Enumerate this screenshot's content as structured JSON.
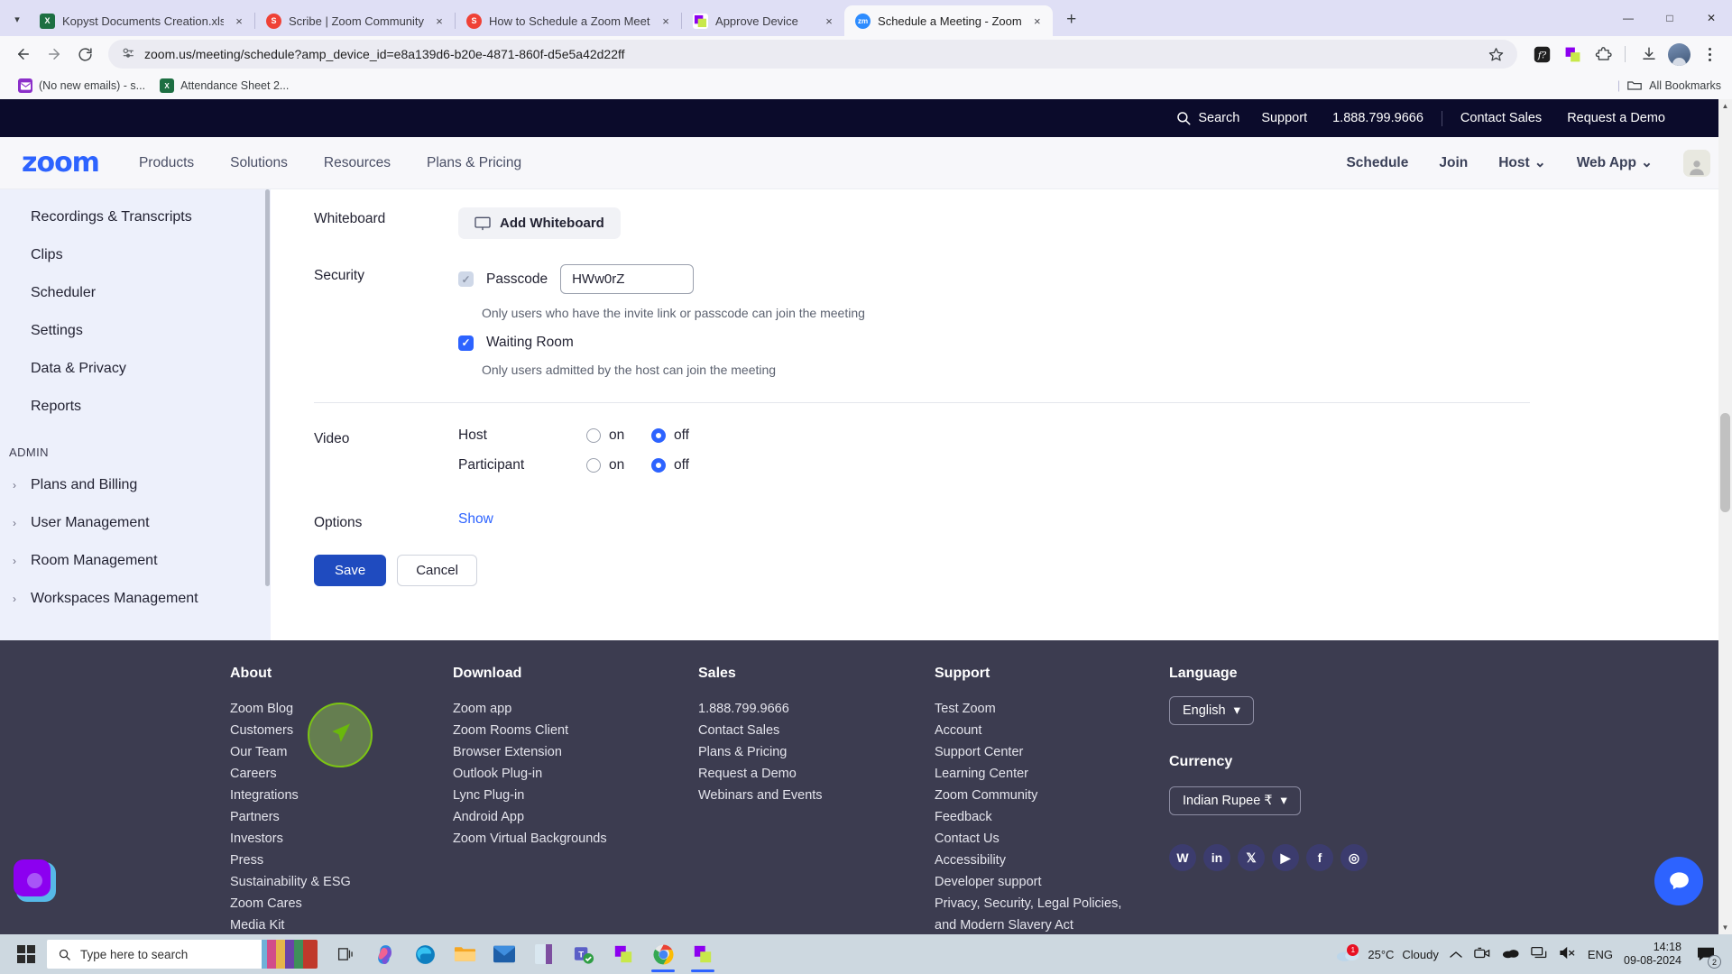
{
  "browser": {
    "tabs": [
      {
        "title": "Kopyst Documents Creation.xlsx",
        "icon": "excel-icon",
        "active": false
      },
      {
        "title": "Scribe | Zoom Community",
        "icon": "scribe-icon",
        "active": false
      },
      {
        "title": "How to Schedule a Zoom Meeti",
        "icon": "scribe-icon",
        "active": false
      },
      {
        "title": "Approve Device",
        "icon": "kopyst-icon",
        "active": false
      },
      {
        "title": "Schedule a Meeting - Zoom",
        "icon": "zoom-icon",
        "active": true
      }
    ],
    "new_tab_label": "+",
    "tab_close_label": "×",
    "window_controls": {
      "minimize": "—",
      "maximize": "□",
      "close": "✕"
    },
    "url": "zoom.us/meeting/schedule?amp_device_id=e8a139d6-b20e-4871-860f-d5e5a42d22ff",
    "toolbar_icons": [
      "back-icon",
      "forward-icon",
      "reload-icon",
      "site-info-icon",
      "bookmark-star-icon",
      "grammarly-icon",
      "kopyst-icon",
      "extensions-icon",
      "downloads-icon",
      "profile-avatar-icon",
      "chrome-menu-icon"
    ],
    "bookmarks": [
      {
        "label": "(No new emails) - s...",
        "icon": "mail-icon"
      },
      {
        "label": "Attendance Sheet 2...",
        "icon": "excel-icon"
      }
    ],
    "all_bookmarks_label": "All Bookmarks"
  },
  "zoom_utility": {
    "search_label": "Search",
    "links": [
      "Support",
      "1.888.799.9666"
    ],
    "right_links": [
      "Contact Sales",
      "Request a Demo"
    ]
  },
  "zoom_nav": {
    "logo": "zoom",
    "links": [
      "Products",
      "Solutions",
      "Resources",
      "Plans & Pricing"
    ],
    "right_links": [
      {
        "label": "Schedule",
        "caret": false
      },
      {
        "label": "Join",
        "caret": false
      },
      {
        "label": "Host",
        "caret": true
      },
      {
        "label": "Web App",
        "caret": true
      }
    ],
    "caret": "⌄"
  },
  "sidebar": {
    "items": [
      {
        "label": "Recordings & Transcripts",
        "caret": false
      },
      {
        "label": "Clips",
        "caret": false
      },
      {
        "label": "Scheduler",
        "caret": false
      },
      {
        "label": "Settings",
        "caret": false
      },
      {
        "label": "Data & Privacy",
        "caret": false
      },
      {
        "label": "Reports",
        "caret": false
      }
    ],
    "section_label": "ADMIN",
    "admin_items": [
      {
        "label": "Plans and Billing",
        "caret": true
      },
      {
        "label": "User Management",
        "caret": true
      },
      {
        "label": "Room Management",
        "caret": true
      },
      {
        "label": "Workspaces Management",
        "caret": true
      }
    ],
    "caret": "›"
  },
  "form": {
    "whiteboard": {
      "label": "Whiteboard",
      "button_label": "Add Whiteboard"
    },
    "security": {
      "label": "Security",
      "passcode_label": "Passcode",
      "passcode_value": "HWw0rZ",
      "passcode_checked": true,
      "passcode_helper": "Only users who have the invite link or passcode can join the meeting",
      "waiting_room_label": "Waiting Room",
      "waiting_room_checked": true,
      "waiting_room_helper": "Only users admitted by the host can join the meeting",
      "check_glyph": "✓"
    },
    "video": {
      "label": "Video",
      "rows": [
        {
          "name": "Host",
          "on_label": "on",
          "off_label": "off",
          "selected": "off"
        },
        {
          "name": "Participant",
          "on_label": "on",
          "off_label": "off",
          "selected": "off"
        }
      ]
    },
    "options": {
      "label": "Options",
      "show_label": "Show"
    },
    "buttons": {
      "save_label": "Save",
      "cancel_label": "Cancel"
    }
  },
  "footer": {
    "columns": [
      {
        "heading": "About",
        "links": [
          "Zoom Blog",
          "Customers",
          "Our Team",
          "Careers",
          "Integrations",
          "Partners",
          "Investors",
          "Press",
          "Sustainability & ESG",
          "Zoom Cares",
          "Media Kit"
        ]
      },
      {
        "heading": "Download",
        "links": [
          "Zoom app",
          "Zoom Rooms Client",
          "Browser Extension",
          "Outlook Plug-in",
          "Lync Plug-in",
          "Android App",
          "Zoom Virtual Backgrounds"
        ]
      },
      {
        "heading": "Sales",
        "links": [
          "1.888.799.9666",
          "Contact Sales",
          "Plans & Pricing",
          "Request a Demo",
          "Webinars and Events"
        ]
      },
      {
        "heading": "Support",
        "links": [
          "Test Zoom",
          "Account",
          "Support Center",
          "Learning Center",
          "Zoom Community",
          "Feedback",
          "Contact Us",
          "Accessibility",
          "Developer support",
          "Privacy, Security, Legal Policies,",
          "and Modern Slavery Act"
        ]
      }
    ],
    "language_heading": "Language",
    "language_value": "English",
    "currency_heading": "Currency",
    "currency_value": "Indian Rupee ₹",
    "picker_caret": "▾",
    "socials": [
      {
        "name": "wordpress-icon",
        "glyph": "W"
      },
      {
        "name": "linkedin-icon",
        "glyph": "in"
      },
      {
        "name": "x-twitter-icon",
        "glyph": "𝕏"
      },
      {
        "name": "youtube-icon",
        "glyph": "▶"
      },
      {
        "name": "facebook-icon",
        "glyph": "f"
      },
      {
        "name": "instagram-icon",
        "glyph": "◎"
      }
    ]
  },
  "taskbar": {
    "search_placeholder": "Type here to search",
    "apps": [
      "task-view-icon",
      "copilot-icon",
      "edge-icon",
      "file-explorer-icon",
      "mail-icon",
      "onenote-icon",
      "teams-icon",
      "kopyst-icon",
      "chrome-icon",
      "kopyst-icon"
    ],
    "temperature": "25°C",
    "weather": "Cloudy",
    "weather_badge": "1",
    "language": "ENG",
    "time": "14:18",
    "date": "09-08-2024",
    "notification_count": "2"
  },
  "colors": {
    "zoom_blue": "#2d63ff",
    "zoom_dark": "#0b0b2b",
    "footer_bg": "#3c3c50",
    "save_blue": "#1f4bbf",
    "cursor_green": "#7cc414"
  }
}
